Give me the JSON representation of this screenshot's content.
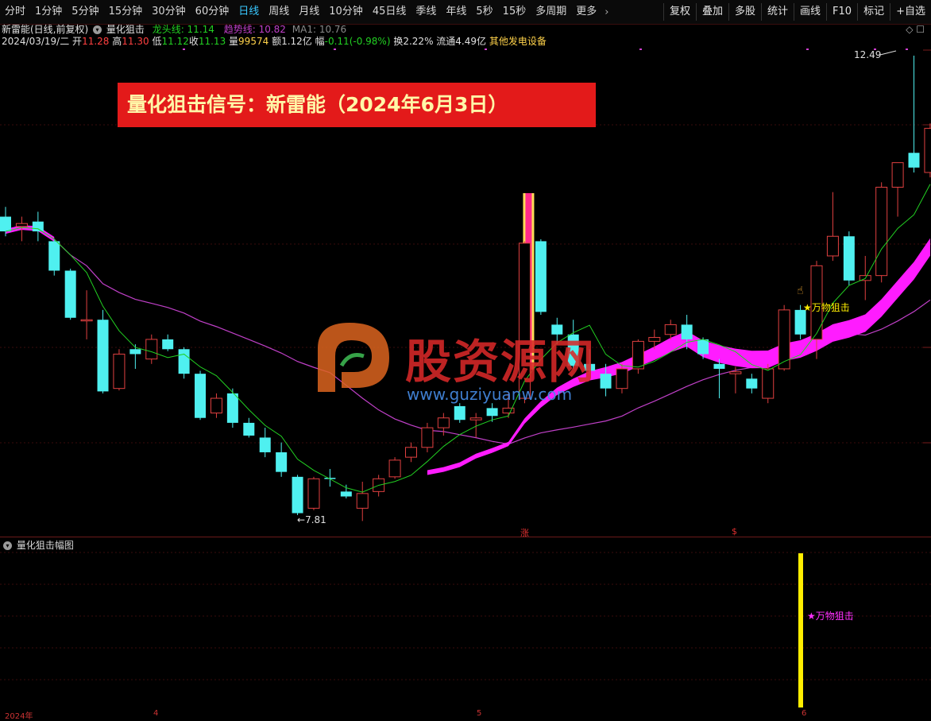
{
  "toolbar": {
    "periods": [
      "分时",
      "1分钟",
      "5分钟",
      "15分钟",
      "30分钟",
      "60分钟",
      "日线",
      "周线",
      "月线",
      "10分钟",
      "45日线",
      "季线",
      "年线",
      "5秒",
      "15秒",
      "多周期",
      "更多"
    ],
    "active_period": "日线",
    "more_chevron": "›",
    "right_buttons": [
      "复权",
      "叠加",
      "多股",
      "统计",
      "画线",
      "F10",
      "标记",
      "+自选"
    ]
  },
  "info": {
    "stock_name": "新雷能(日线,前复权)",
    "indicator_name": "量化狙击",
    "dragon_label": "龙头线: 11.14",
    "trend_label": "趋势线: 10.82",
    "ma_label": "MA1: 10.76",
    "date": "2024/03/19/二",
    "open_label": "开",
    "open": "11.28",
    "high_label": "高",
    "high": "11.30",
    "low_label": "低",
    "low": "11.12",
    "close_label": "收",
    "close": "11.13",
    "volume_label": "量",
    "volume": "99574",
    "amount": "额1.12亿",
    "change_label": "幅",
    "change": "-0.11(-0.98%)",
    "turnover": "换2.22%",
    "float_value": "流通4.49亿",
    "sector": "其他发电设备"
  },
  "top_right_icons": "◇ ☐",
  "banner": "量化狙击信号：新雷能（2024年6月3日）",
  "chart_labels": {
    "high_price": "12.49",
    "low_price": "7.81",
    "signal_main": "★万物狙击",
    "marker_zhang": "涨",
    "marker_s": "$"
  },
  "sub_chart": {
    "title": "量化狙击幅图",
    "signal_label": "★万物狙击"
  },
  "watermark": {
    "text": "股资源网",
    "url": "www.guziyuanw.com"
  },
  "date_axis": [
    "2024年",
    "4",
    "5",
    "6"
  ],
  "colors": {
    "up_candle": "#e04040",
    "down_candle": "#4ff0f0",
    "ma_green": "#22d022",
    "trend_purple": "#c040c8",
    "ribbon": "#ff1cff",
    "signal_yellow": "#ffee00"
  },
  "chart_data": {
    "type": "candlestick",
    "price_range": [
      7.81,
      12.49
    ],
    "candles": [
      {
        "o": 10.85,
        "h": 10.95,
        "l": 10.65,
        "c": 10.7
      },
      {
        "o": 10.75,
        "h": 10.85,
        "l": 10.6,
        "c": 10.78
      },
      {
        "o": 10.8,
        "h": 10.9,
        "l": 10.6,
        "c": 10.7
      },
      {
        "o": 10.6,
        "h": 10.62,
        "l": 10.25,
        "c": 10.3
      },
      {
        "o": 10.3,
        "h": 10.32,
        "l": 9.8,
        "c": 9.82
      },
      {
        "o": 9.8,
        "h": 10.1,
        "l": 9.6,
        "c": 9.8
      },
      {
        "o": 9.8,
        "h": 9.9,
        "l": 9.05,
        "c": 9.07
      },
      {
        "o": 9.1,
        "h": 9.5,
        "l": 9.08,
        "c": 9.45
      },
      {
        "o": 9.5,
        "h": 9.55,
        "l": 9.3,
        "c": 9.45
      },
      {
        "o": 9.4,
        "h": 9.65,
        "l": 9.35,
        "c": 9.6
      },
      {
        "o": 9.6,
        "h": 9.65,
        "l": 9.48,
        "c": 9.5
      },
      {
        "o": 9.5,
        "h": 9.52,
        "l": 9.2,
        "c": 9.25
      },
      {
        "o": 9.25,
        "h": 9.28,
        "l": 8.78,
        "c": 8.8
      },
      {
        "o": 8.85,
        "h": 9.05,
        "l": 8.8,
        "c": 9.0
      },
      {
        "o": 9.05,
        "h": 9.1,
        "l": 8.7,
        "c": 8.75
      },
      {
        "o": 8.75,
        "h": 8.8,
        "l": 8.6,
        "c": 8.62
      },
      {
        "o": 8.6,
        "h": 8.7,
        "l": 8.4,
        "c": 8.45
      },
      {
        "o": 8.45,
        "h": 8.55,
        "l": 8.2,
        "c": 8.25
      },
      {
        "o": 8.2,
        "h": 8.22,
        "l": 7.81,
        "c": 7.83
      },
      {
        "o": 7.88,
        "h": 8.2,
        "l": 7.86,
        "c": 8.18
      },
      {
        "o": 8.19,
        "h": 8.28,
        "l": 8.1,
        "c": 8.18
      },
      {
        "o": 8.05,
        "h": 8.12,
        "l": 7.98,
        "c": 8.0
      },
      {
        "o": 7.88,
        "h": 8.15,
        "l": 7.75,
        "c": 8.03
      },
      {
        "o": 8.05,
        "h": 8.22,
        "l": 8.0,
        "c": 8.18
      },
      {
        "o": 8.2,
        "h": 8.4,
        "l": 8.18,
        "c": 8.37
      },
      {
        "o": 8.4,
        "h": 8.55,
        "l": 8.35,
        "c": 8.5
      },
      {
        "o": 8.5,
        "h": 8.75,
        "l": 8.45,
        "c": 8.7
      },
      {
        "o": 8.7,
        "h": 8.85,
        "l": 8.62,
        "c": 8.8
      },
      {
        "o": 8.92,
        "h": 8.95,
        "l": 8.75,
        "c": 8.78
      },
      {
        "o": 8.78,
        "h": 8.85,
        "l": 8.6,
        "c": 8.8
      },
      {
        "o": 8.9,
        "h": 8.95,
        "l": 8.76,
        "c": 8.82
      },
      {
        "o": 8.85,
        "h": 9.05,
        "l": 8.8,
        "c": 8.9
      },
      {
        "o": 9.0,
        "h": 10.6,
        "l": 8.95,
        "c": 10.58
      },
      {
        "o": 10.6,
        "h": 10.62,
        "l": 9.85,
        "c": 9.88
      },
      {
        "o": 9.75,
        "h": 9.82,
        "l": 9.55,
        "c": 9.65
      },
      {
        "o": 9.65,
        "h": 9.8,
        "l": 9.3,
        "c": 9.33
      },
      {
        "o": 9.35,
        "h": 9.5,
        "l": 9.25,
        "c": 9.28
      },
      {
        "o": 9.25,
        "h": 9.35,
        "l": 9.02,
        "c": 9.1
      },
      {
        "o": 9.1,
        "h": 9.35,
        "l": 9.05,
        "c": 9.3
      },
      {
        "o": 9.3,
        "h": 9.6,
        "l": 9.25,
        "c": 9.58
      },
      {
        "o": 9.58,
        "h": 9.7,
        "l": 9.5,
        "c": 9.62
      },
      {
        "o": 9.65,
        "h": 9.8,
        "l": 9.6,
        "c": 9.75
      },
      {
        "o": 9.75,
        "h": 9.85,
        "l": 9.5,
        "c": 9.6
      },
      {
        "o": 9.6,
        "h": 9.62,
        "l": 9.4,
        "c": 9.45
      },
      {
        "o": 9.35,
        "h": 9.4,
        "l": 9.0,
        "c": 9.3
      },
      {
        "o": 9.25,
        "h": 9.32,
        "l": 9.05,
        "c": 9.27
      },
      {
        "o": 9.2,
        "h": 9.25,
        "l": 9.05,
        "c": 9.1
      },
      {
        "o": 9.0,
        "h": 9.35,
        "l": 8.95,
        "c": 9.3
      },
      {
        "o": 9.3,
        "h": 9.95,
        "l": 9.28,
        "c": 9.9
      },
      {
        "o": 9.9,
        "h": 9.95,
        "l": 9.6,
        "c": 9.65
      },
      {
        "o": 9.6,
        "h": 10.4,
        "l": 9.4,
        "c": 10.35
      },
      {
        "o": 10.45,
        "h": 11.1,
        "l": 10.4,
        "c": 10.65
      },
      {
        "o": 10.65,
        "h": 10.7,
        "l": 10.15,
        "c": 10.2
      },
      {
        "o": 10.2,
        "h": 10.45,
        "l": 10.0,
        "c": 10.25
      },
      {
        "o": 10.25,
        "h": 11.2,
        "l": 10.18,
        "c": 11.15
      },
      {
        "o": 11.15,
        "h": 11.4,
        "l": 10.85,
        "c": 11.4
      },
      {
        "o": 11.5,
        "h": 12.49,
        "l": 11.3,
        "c": 11.35
      },
      {
        "o": 11.3,
        "h": 11.8,
        "l": 11.25,
        "c": 11.75
      }
    ]
  }
}
